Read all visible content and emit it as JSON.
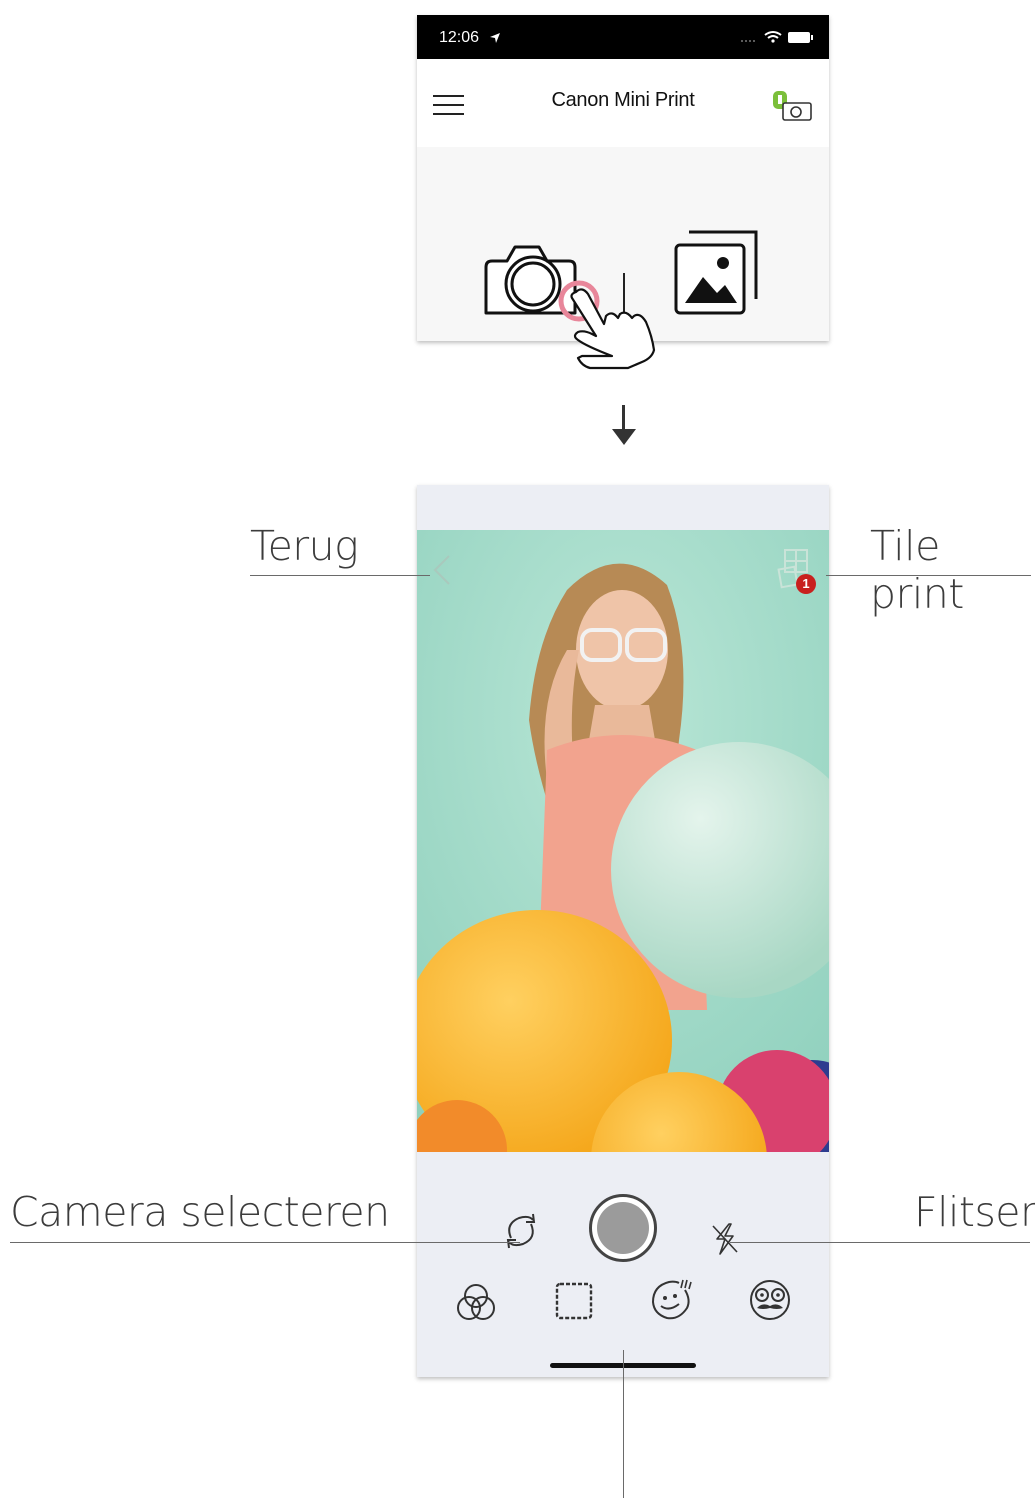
{
  "status_bar": {
    "time": "12:06"
  },
  "app_bar": {
    "title": "Canon Mini Print"
  },
  "tile_print": {
    "badge_count": "1"
  },
  "callouts": {
    "back": "Terug",
    "tile_print": "Tile print",
    "camera_select": "Camera selecteren",
    "flash": "Flitser"
  },
  "icons": {
    "menu": "hamburger-menu-icon",
    "printer_status": "printer-battery-icon",
    "camera": "camera-icon",
    "gallery": "photo-gallery-icon",
    "back": "chevron-left-icon",
    "tile_print": "tile-grid-icon",
    "switch_camera": "camera-switch-icon",
    "flash": "flash-off-icon",
    "filters": "filters-icon",
    "frames": "frame-icon",
    "stickers": "sticker-face-icon",
    "masks": "mustache-mask-icon"
  },
  "colors": {
    "badge": "#c8201e",
    "battery": "#7bbf3a",
    "tap_ring": "#e8869a"
  }
}
